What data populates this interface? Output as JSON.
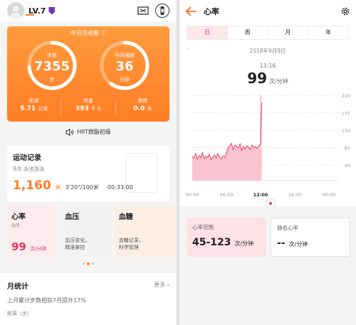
{
  "left": {
    "level": "LV.7",
    "activity": {
      "title": "今日活动量",
      "steps": {
        "label": "步数",
        "value": "7355",
        "unit": "步",
        "progress": 0.74
      },
      "intensity": {
        "label": "中高强度",
        "value": "36",
        "unit": "分钟",
        "progress": 0.6
      },
      "stats": [
        {
          "label": "距离",
          "value": "5.71",
          "unit": "公里"
        },
        {
          "label": "热量",
          "value": "393",
          "unit": "千卡"
        },
        {
          "label": "爬楼",
          "value": "0.0",
          "unit": "米"
        }
      ]
    },
    "hiit": "HIIT燃脂初级",
    "sport": {
      "title": "运动记录",
      "date": "9/8",
      "activity": "泳池游泳",
      "distance": "1,160",
      "distance_unit": "米",
      "pace": "3'20\"/100米",
      "duration": "00:33:00"
    },
    "cards": {
      "heart": {
        "title": "心率",
        "date": "9/9",
        "value": "99",
        "unit": "次/分钟"
      },
      "bp": {
        "title": "血压",
        "desc1": "血压变化，",
        "desc2": "精准掌控"
      },
      "sugar": {
        "title": "血糖",
        "desc1": "血糖记录，",
        "desc2": "科学管理"
      }
    },
    "monthly": {
      "title": "月统计",
      "more": "更多",
      "summary": "上月累计步数相较7月提升17%",
      "sub": "距离（步）"
    }
  },
  "right": {
    "title": "心率",
    "tabs": [
      "日",
      "周",
      "月",
      "年"
    ],
    "active_tab": 0,
    "date": "2018年9月9日",
    "time": "13:16",
    "bpm": "99",
    "bpm_unit": "次/分钟",
    "range_label": "心率范围",
    "range_value": "45-123",
    "range_unit": "次/分钟",
    "resting_label": "静息心率",
    "resting_value": "--",
    "resting_unit": "次/分钟"
  },
  "chart_data": {
    "type": "area",
    "title": "",
    "xlabel": "",
    "ylabel": "",
    "x_ticks": [
      "00:00",
      "06:00",
      "12:00",
      "18:00",
      "00:00"
    ],
    "y_ticks": [
      40,
      85,
      130,
      175,
      220
    ],
    "ylim": [
      0,
      220
    ],
    "xlim": [
      0,
      24
    ],
    "highlight_x": 12,
    "series": [
      {
        "color": "#e33a5d",
        "x": [
          0.0,
          0.3,
          0.6,
          0.9,
          1.2,
          1.5,
          1.8,
          2.1,
          2.4,
          2.7,
          3.0,
          3.3,
          3.6,
          3.9,
          4.2,
          4.5,
          4.8,
          5.1,
          5.4,
          5.7,
          6.0,
          6.3,
          6.6,
          6.9,
          7.2,
          7.5,
          7.8,
          8.1,
          8.4,
          8.7,
          9.0,
          9.3,
          9.6,
          9.9,
          10.2,
          10.5,
          10.8,
          11.1,
          11.4,
          11.7,
          12.0,
          12.2
        ],
        "values": [
          62,
          58,
          70,
          55,
          65,
          60,
          72,
          57,
          63,
          59,
          68,
          54,
          61,
          66,
          58,
          70,
          62,
          56,
          64,
          60,
          72,
          85,
          90,
          96,
          80,
          92,
          88,
          84,
          95,
          78,
          88,
          82,
          90,
          86,
          80,
          92,
          85,
          88,
          84,
          90,
          95,
          200
        ]
      }
    ]
  }
}
